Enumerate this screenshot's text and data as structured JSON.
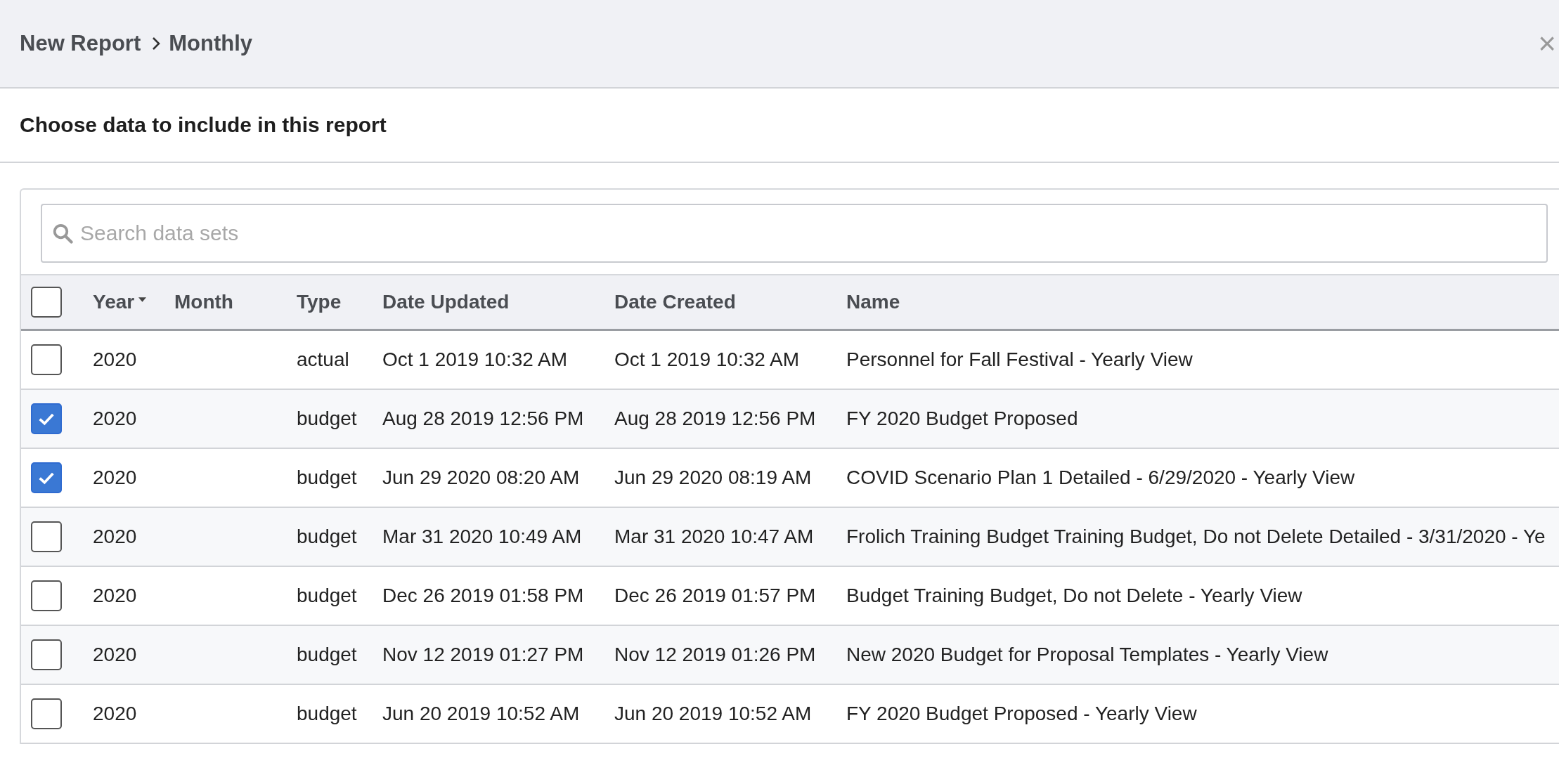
{
  "breadcrumb": [
    {
      "label": "New Report"
    },
    {
      "label": "Monthly"
    }
  ],
  "close": "×",
  "section_title": "Choose data to include in this report",
  "search": {
    "placeholder": "Search data sets"
  },
  "table": {
    "select_all": {
      "checked": false
    },
    "columns": [
      {
        "label": "Year",
        "sorted": true
      },
      {
        "label": "Month",
        "sorted": false
      },
      {
        "label": "Type",
        "sorted": false
      },
      {
        "label": "Date Updated",
        "sorted": false
      },
      {
        "label": "Date Created",
        "sorted": false
      },
      {
        "label": "Name",
        "sorted": false
      }
    ],
    "rows": [
      {
        "checked": false,
        "year": "2020",
        "type": "actual",
        "updated": "Oct 1 2019 10:32 AM",
        "created": "Oct 1 2019 10:32 AM",
        "name": "Personnel for Fall Festival - Yearly View"
      },
      {
        "checked": true,
        "year": "2020",
        "type": "budget",
        "updated": "Aug 28 2019 12:56 PM",
        "created": "Aug 28 2019 12:56 PM",
        "name": "FY 2020 Budget Proposed"
      },
      {
        "checked": true,
        "year": "2020",
        "type": "budget",
        "updated": "Jun 29 2020 08:20 AM",
        "created": "Jun 29 2020 08:19 AM",
        "name": "COVID Scenario Plan 1 Detailed - 6/29/2020 - Yearly View"
      },
      {
        "checked": false,
        "year": "2020",
        "type": "budget",
        "updated": "Mar 31 2020 10:49 AM",
        "created": "Mar 31 2020 10:47 AM",
        "name": "Frolich Training Budget Training Budget, Do not Delete Detailed - 3/31/2020 - Ye"
      },
      {
        "checked": false,
        "year": "2020",
        "type": "budget",
        "updated": "Dec 26 2019 01:58 PM",
        "created": "Dec 26 2019 01:57 PM",
        "name": "Budget Training Budget, Do not Delete - Yearly View"
      },
      {
        "checked": false,
        "year": "2020",
        "type": "budget",
        "updated": "Nov 12 2019 01:27 PM",
        "created": "Nov 12 2019 01:26 PM",
        "name": "New 2020 Budget for Proposal Templates - Yearly View"
      },
      {
        "checked": false,
        "year": "2020",
        "type": "budget",
        "updated": "Jun 20 2019 10:52 AM",
        "created": "Jun 20 2019 10:52 AM",
        "name": "FY 2020 Budget Proposed - Yearly View"
      }
    ]
  }
}
